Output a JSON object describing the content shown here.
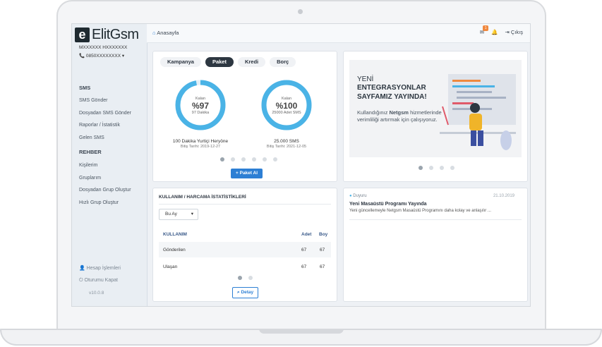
{
  "brand": {
    "logo_letter": "e",
    "logo_text": "ElitGsm"
  },
  "user": {
    "name": "MXXXXXX HXXXXXXX",
    "phone": "0850XXXXXXXX"
  },
  "sidebar": {
    "sections": [
      {
        "heading": "SMS",
        "items": [
          "SMS Gönder",
          "Dosyadan SMS Gönder",
          "Raporlar / İstatistik",
          "Gelen SMS"
        ]
      },
      {
        "heading": "REHBER",
        "items": [
          "Kişilerim",
          "Gruplarım",
          "Dosyadan Grup Oluştur",
          "Hızlı Grup Oluştur"
        ]
      }
    ],
    "bottom": [
      "Hesap İşlemleri",
      "Oturumu Kapat"
    ],
    "version": "v10.0.8"
  },
  "topbar": {
    "breadcrumb": "Anasayfa",
    "mail_count": "1",
    "logout": "Çıkış"
  },
  "packages": {
    "tabs": [
      "Kampanya",
      "Paket",
      "Kredi",
      "Borç"
    ],
    "active_tab": "Paket",
    "items": [
      {
        "label": "Kalan",
        "percent": "%97",
        "sub": "97 Dakika",
        "remaining_fraction": 0.97,
        "title": "100 Dakika Yurtiçi Heryöne",
        "date": "Bitiş Tarihi: 2019-12-27"
      },
      {
        "label": "Kalan",
        "percent": "%100",
        "sub": "25000 Adet SMS",
        "remaining_fraction": 1.0,
        "title": "25.000 SMS",
        "date": "Bitiş Tarihi: 2021-12-05"
      }
    ],
    "button": "Paket Al"
  },
  "banner": {
    "line1": "YENİ",
    "line2": "ENTEGRASYONLAR",
    "line3": "SAYFAMIZ YAYINDA!",
    "body_pre": "Kullandığınız",
    "body_bold": "Netgsm",
    "body_post": "hizmetlerinde verimliliği artırmak için çalışıyoruz."
  },
  "stats": {
    "title": "KULLANIM / HARCAMA İSTATİSTİKLERİ",
    "period": "Bu Ay",
    "columns": [
      "KULLANIM",
      "Adet",
      "Boy"
    ],
    "rows": [
      {
        "name": "Gönderilen",
        "adet": "67",
        "boy": "67"
      },
      {
        "name": "Ulaşan",
        "adet": "67",
        "boy": "67"
      }
    ],
    "button": "Detay"
  },
  "announcement": {
    "tag": "Duyuru",
    "date": "21.10.2019",
    "title": "Yeni Masaüstü Programı Yayında",
    "text": "Yeni güncellemeyle Netgsm Masaüstü Programını daha kolay ve anlaşılır ..."
  },
  "colors": {
    "accent": "#2d7fd4",
    "ring": "#4ab3e6",
    "dark": "#2d3741",
    "badge": "#f0883e"
  }
}
